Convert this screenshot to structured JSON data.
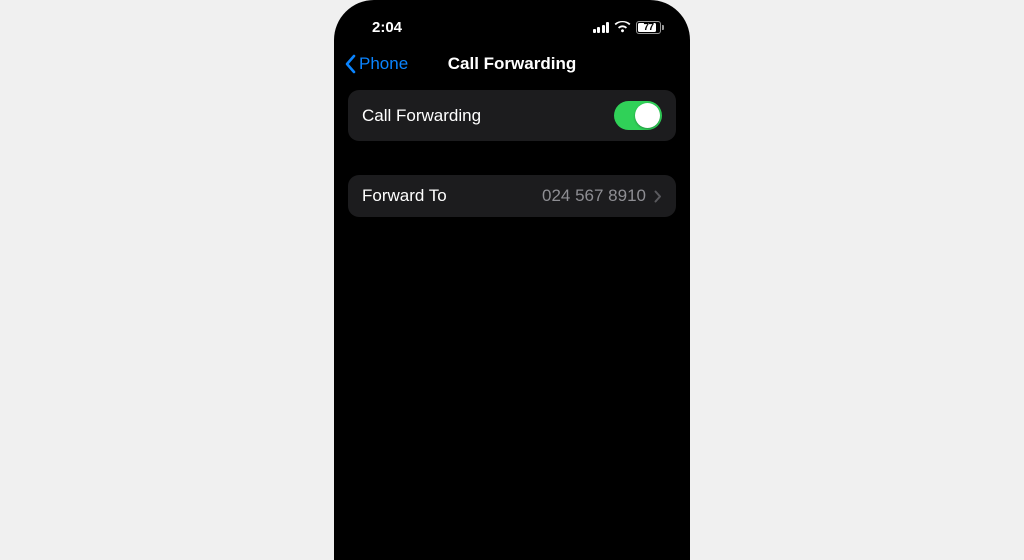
{
  "status": {
    "time": "2:04",
    "battery": "77"
  },
  "nav": {
    "back": "Phone",
    "title": "Call Forwarding"
  },
  "rows": {
    "toggle_label": "Call Forwarding",
    "forward_label": "Forward To",
    "forward_value": "024 567 8910"
  }
}
